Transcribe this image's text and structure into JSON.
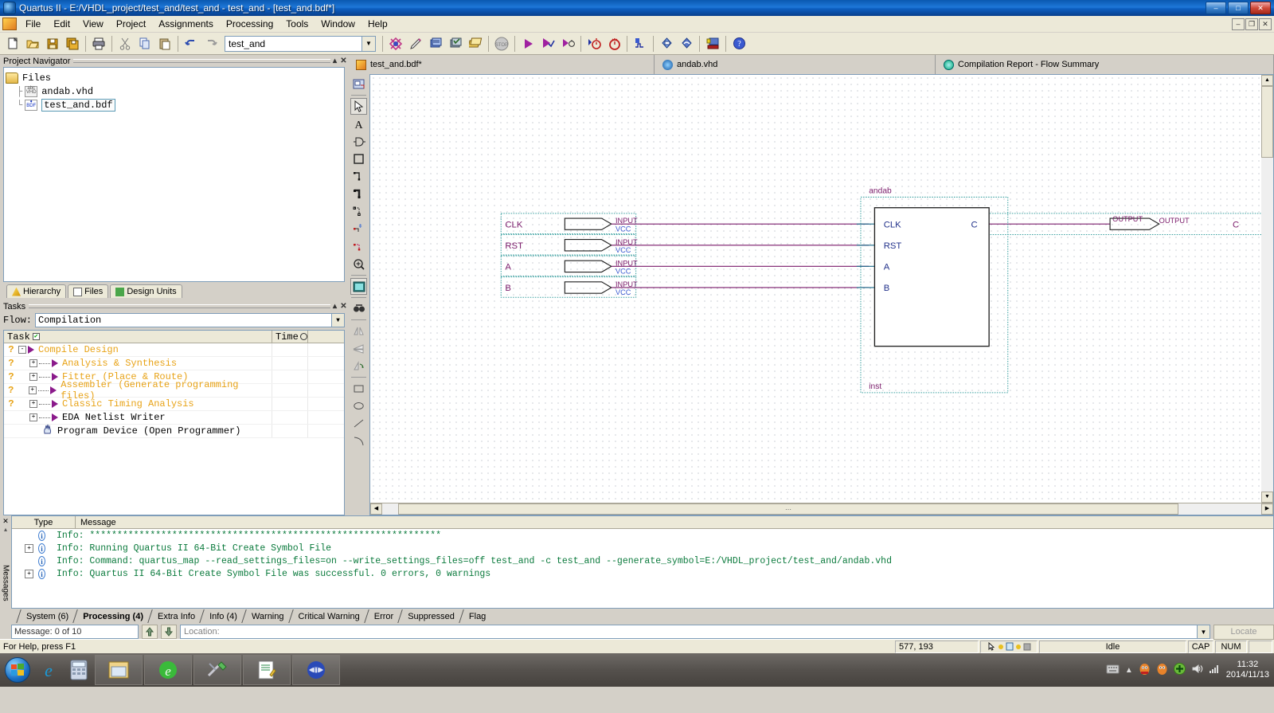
{
  "window": {
    "title": "Quartus II - E:/VHDL_project/test_and/test_and - test_and - [test_and.bdf*]",
    "minimize": "–",
    "maximize": "□",
    "close": "✕",
    "inner_minimize": "–",
    "inner_restore": "❐",
    "inner_close": "✕"
  },
  "menu": {
    "items": [
      "File",
      "Edit",
      "View",
      "Project",
      "Assignments",
      "Processing",
      "Tools",
      "Window",
      "Help"
    ]
  },
  "toolbar": {
    "project_combo_value": "test_and",
    "buttons": [
      "new-file-icon",
      "open-file-icon",
      "save-icon",
      "save-all-icon",
      "print-icon",
      "cut-icon",
      "copy-icon",
      "paste-icon",
      "undo-icon",
      "redo-icon"
    ],
    "buttons_right": [
      "compile-design-icon",
      "analysis-synthesis-icon",
      "fitter-icon",
      "assembler-icon",
      "timing-analyzer-icon",
      "stop-icon",
      "start-compilation-icon",
      "start-analysis-icon",
      "start-analysis-elaboration-icon",
      "timing-analyzer-tool-icon",
      "classic-timing-icon",
      "waveform-icon",
      "rtl-viewer-icon",
      "technology-map-icon",
      "programmer-icon",
      "help-icon"
    ]
  },
  "project_navigator": {
    "title": "Project Navigator",
    "collapse_glyph": "▴",
    "close_glyph": "✕",
    "root": "Files",
    "files": [
      {
        "name": "andab.vhd",
        "type": "VHD",
        "selected": false
      },
      {
        "name": "test_and.bdf",
        "type": "BDF",
        "selected": true
      }
    ],
    "tabs": [
      {
        "label": "Hierarchy",
        "icon": "hierarchy-icon",
        "active": false
      },
      {
        "label": "Files",
        "icon": "files-icon",
        "active": true
      },
      {
        "label": "Design Units",
        "icon": "design-units-icon",
        "active": false
      }
    ]
  },
  "tasks": {
    "title": "Tasks",
    "collapse_glyph": "▴",
    "close_glyph": "✕",
    "flow_label": "Flow:",
    "flow_value": "Compilation",
    "columns": {
      "task": "Task",
      "time": "Time"
    },
    "rows": [
      {
        "label": "Compile Design",
        "status": "?",
        "expander": "-",
        "indent": 0,
        "color": "orange",
        "icon": "play-icon"
      },
      {
        "label": "Analysis & Synthesis",
        "status": "?",
        "expander": "+",
        "indent": 1,
        "color": "orange",
        "icon": "play-icon"
      },
      {
        "label": "Fitter (Place & Route)",
        "status": "?",
        "expander": "+",
        "indent": 1,
        "color": "orange",
        "icon": "play-icon"
      },
      {
        "label": "Assembler (Generate programming files)",
        "status": "?",
        "expander": "+",
        "indent": 1,
        "color": "orange",
        "icon": "play-icon"
      },
      {
        "label": "Classic Timing Analysis",
        "status": "?",
        "expander": "+",
        "indent": 1,
        "color": "orange",
        "icon": "play-icon"
      },
      {
        "label": "EDA Netlist Writer",
        "status": "",
        "expander": "+",
        "indent": 1,
        "color": "black",
        "icon": "play-icon"
      },
      {
        "label": "Program Device (Open Programmer)",
        "status": "",
        "expander": "",
        "indent": 1,
        "color": "black",
        "icon": "hand-icon"
      }
    ]
  },
  "editor": {
    "tabs": [
      {
        "label": "test_and.bdf*",
        "icon": "bdf-file-icon",
        "active": true
      },
      {
        "label": "andab.vhd",
        "icon": "vhd-file-icon",
        "active": false
      },
      {
        "label": "Compilation Report - Flow Summary",
        "icon": "report-icon",
        "active": false
      }
    ],
    "tools": [
      "symbol-tool-icon",
      "selection-tool-icon",
      "text-tool-icon",
      "symbol-icon",
      "block-tool-icon",
      "orthogonal-node-tool-icon",
      "orthogonal-bus-tool-icon",
      "orthogonal-conduit-tool-icon",
      "rubberbanding-icon",
      "partial-line-icon",
      "zoom-tool-icon",
      "fit-in-window-icon",
      "find-icon",
      "flip-horizontal-icon",
      "flip-vertical-icon",
      "rotate-icon",
      "rectangle-icon",
      "oval-icon",
      "line-icon",
      "arc-icon"
    ],
    "schematic": {
      "inputs": [
        {
          "name": "CLK",
          "pin_type": "INPUT",
          "default": "VCC"
        },
        {
          "name": "RST",
          "pin_type": "INPUT",
          "default": "VCC"
        },
        {
          "name": "A",
          "pin_type": "INPUT",
          "default": "VCC"
        },
        {
          "name": "B",
          "pin_type": "INPUT",
          "default": "VCC"
        }
      ],
      "block": {
        "name": "andab",
        "instance": "inst",
        "inputs": [
          "CLK",
          "RST",
          "A",
          "B"
        ],
        "outputs": [
          "C"
        ]
      },
      "output": {
        "name": "C",
        "pin_type": "OUTPUT"
      }
    }
  },
  "messages": {
    "gutter_label": "Messages",
    "close_glyph": "✕",
    "columns": {
      "type": "Type",
      "message": "Message"
    },
    "rows": [
      {
        "expander": "",
        "icon": "info-icon",
        "text": "Info: ****************************************************************"
      },
      {
        "expander": "+",
        "icon": "info-icon",
        "text": "Info: Running Quartus II 64-Bit Create Symbol File"
      },
      {
        "expander": "",
        "icon": "info-icon",
        "text": "Info: Command: quartus_map --read_settings_files=on --write_settings_files=off test_and -c test_and --generate_symbol=E:/VHDL_project/test_and/andab.vhd"
      },
      {
        "expander": "+",
        "icon": "info-icon",
        "text": "Info: Quartus II 64-Bit Create Symbol File was successful. 0 errors, 0 warnings"
      }
    ],
    "tabs": [
      {
        "label": "System (6)",
        "active": false
      },
      {
        "label": "Processing (4)",
        "active": true
      },
      {
        "label": "Extra Info",
        "active": false
      },
      {
        "label": "Info (4)",
        "active": false
      },
      {
        "label": "Warning",
        "active": false
      },
      {
        "label": "Critical Warning",
        "active": false
      },
      {
        "label": "Error",
        "active": false
      },
      {
        "label": "Suppressed",
        "active": false
      },
      {
        "label": "Flag",
        "active": false
      }
    ],
    "count_text": "Message: 0 of 10",
    "location_label": "Location:",
    "location_value": "",
    "locate_button": "Locate"
  },
  "status_bar": {
    "help_text": "For Help, press F1",
    "coordinates": "577, 193",
    "state": "Idle",
    "caps": "CAP",
    "num": "NUM"
  },
  "taskbar": {
    "start": "start-orb-icon",
    "quick_launch": [
      "internet-explorer-icon",
      "calculator-icon"
    ],
    "items": [
      "explorer-window-icon",
      "browser-window-icon",
      "tools-window-icon",
      "notepad-window-icon",
      "quartus-window-icon"
    ],
    "tray": [
      "keyboard-icon",
      "show-hidden-icon",
      "qq-icon",
      "qq2-icon",
      "shield-icon",
      "volume-icon",
      "network-icon"
    ],
    "clock_time": "11:32",
    "clock_date": "2014/11/13"
  }
}
